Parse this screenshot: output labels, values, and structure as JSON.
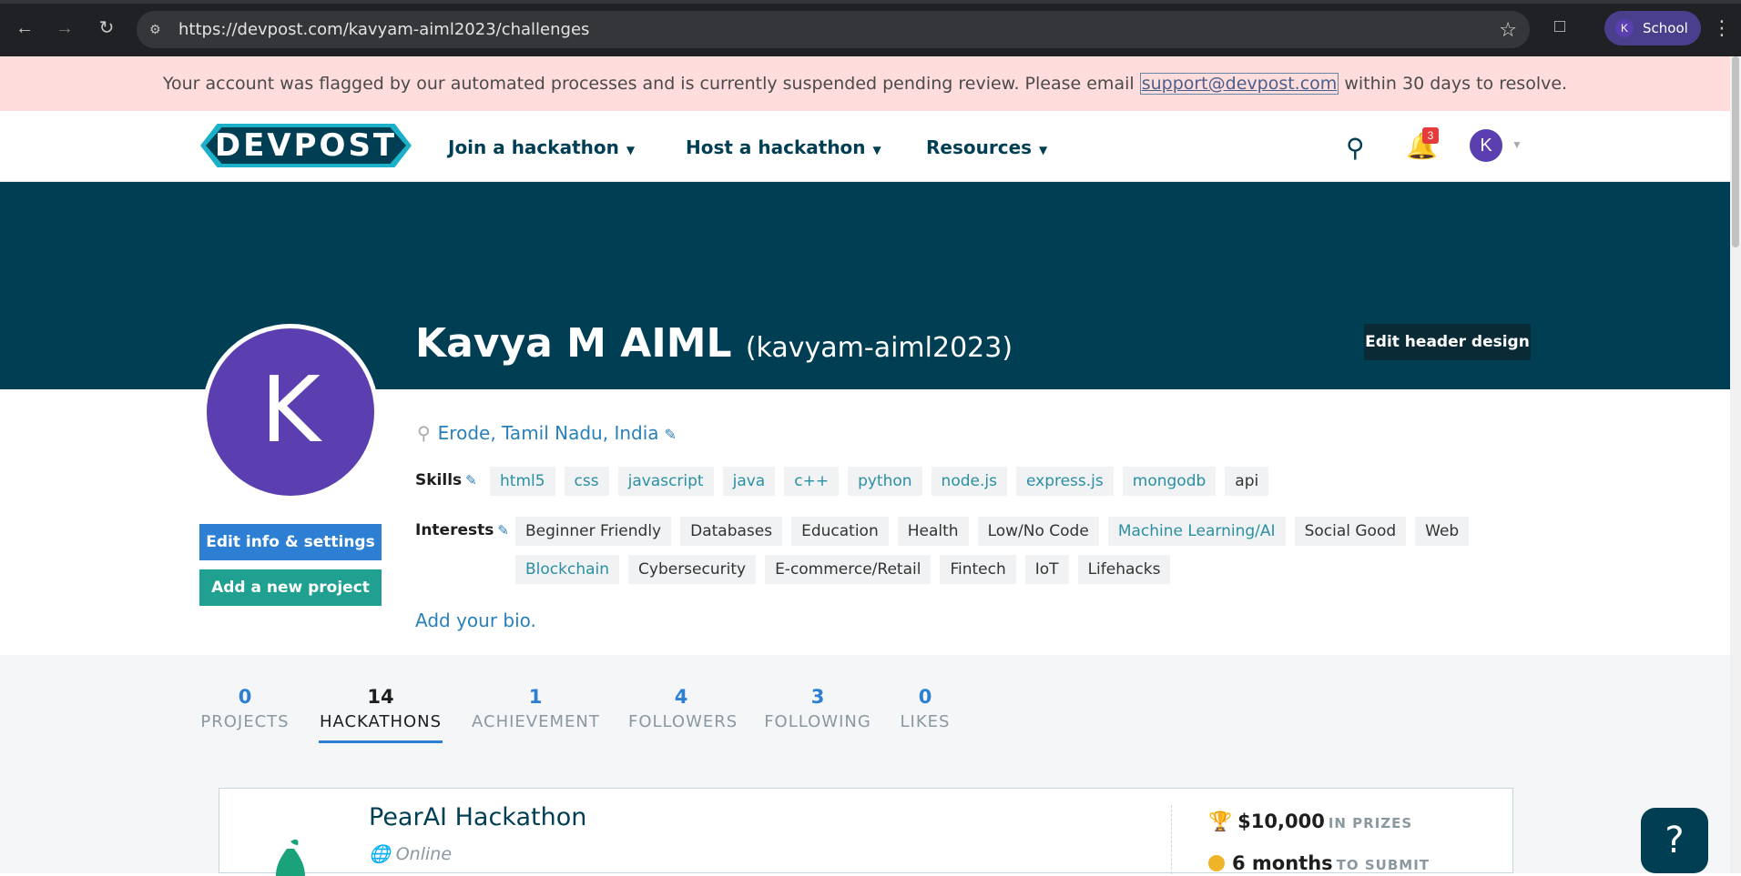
{
  "browser": {
    "url": "https://devpost.com/kavyam-aiml2023/challenges",
    "profile_label": "School",
    "profile_initial": "K"
  },
  "banner": {
    "text_before": "Your account was flagged by our automated processes and is currently suspended pending review. Please email ",
    "email": "support@devpost.com",
    "text_after": " within 30 days to resolve."
  },
  "header": {
    "logo": "DEVPOST",
    "nav": [
      {
        "label": "Join a hackathon"
      },
      {
        "label": "Host a hackathon"
      },
      {
        "label": "Resources"
      }
    ],
    "notification_count": "3",
    "avatar_initial": "K"
  },
  "profile": {
    "avatar_initial": "K",
    "name": "Kavya M AIML",
    "username": "(kavyam-aiml2023)",
    "edit_header_label": "Edit header design",
    "location": "Erode, Tamil Nadu, India",
    "skills_label": "Skills",
    "skills": [
      {
        "label": "html5",
        "linked": true
      },
      {
        "label": "css",
        "linked": true
      },
      {
        "label": "javascript",
        "linked": true
      },
      {
        "label": "java",
        "linked": true
      },
      {
        "label": "c++",
        "linked": true
      },
      {
        "label": "python",
        "linked": true
      },
      {
        "label": "node.js",
        "linked": true
      },
      {
        "label": "express.js",
        "linked": true
      },
      {
        "label": "mongodb",
        "linked": true
      },
      {
        "label": "api",
        "linked": false
      }
    ],
    "interests_label": "Interests",
    "interests": [
      {
        "label": "Beginner Friendly",
        "linked": false
      },
      {
        "label": "Databases",
        "linked": false
      },
      {
        "label": "Education",
        "linked": false
      },
      {
        "label": "Health",
        "linked": false
      },
      {
        "label": "Low/No Code",
        "linked": false
      },
      {
        "label": "Machine Learning/AI",
        "linked": true
      },
      {
        "label": "Social Good",
        "linked": false
      },
      {
        "label": "Web",
        "linked": false
      },
      {
        "label": "Blockchain",
        "linked": true
      },
      {
        "label": "Cybersecurity",
        "linked": false
      },
      {
        "label": "E-commerce/Retail",
        "linked": false
      },
      {
        "label": "Fintech",
        "linked": false
      },
      {
        "label": "IoT",
        "linked": false
      },
      {
        "label": "Lifehacks",
        "linked": false
      }
    ],
    "edit_info_label": "Edit info & settings",
    "add_project_label": "Add a new project",
    "bio_prompt": "Add your bio."
  },
  "stats": [
    {
      "num": "0",
      "label": "PROJECTS"
    },
    {
      "num": "14",
      "label": "HACKATHONS",
      "active": true
    },
    {
      "num": "1",
      "label": "ACHIEVEMENT"
    },
    {
      "num": "4",
      "label": "FOLLOWERS"
    },
    {
      "num": "3",
      "label": "FOLLOWING"
    },
    {
      "num": "0",
      "label": "LIKES"
    }
  ],
  "hackathon_card": {
    "title": "PearAI Hackathon",
    "location": "Online",
    "prize_amount": "$10,000",
    "prize_suffix": "IN PRIZES",
    "time_amount": "6 months",
    "time_suffix": "TO SUBMIT"
  },
  "colors": {
    "brand_dark": "#003e54",
    "accent_blue": "#2d7fd4",
    "accent_teal": "#20a090",
    "banner_bg": "#ffdddd"
  }
}
